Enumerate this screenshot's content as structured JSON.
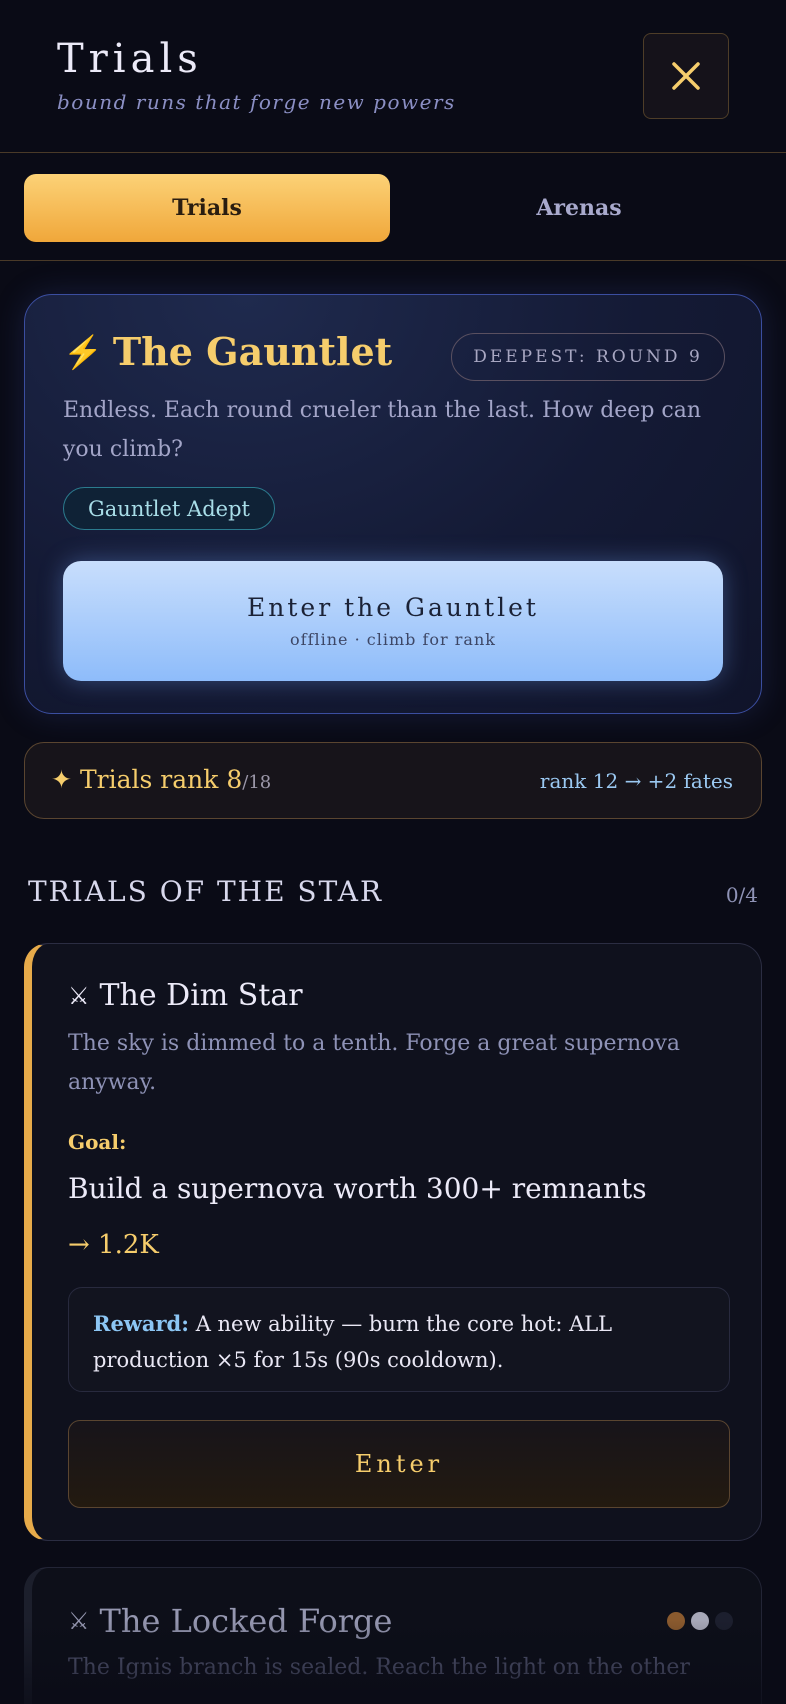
{
  "header": {
    "title": "Trials",
    "subtitle": "bound runs that forge new powers",
    "close_icon": "close-icon"
  },
  "tabs": [
    {
      "label": "Trials",
      "active": true
    },
    {
      "label": "Arenas",
      "active": false
    }
  ],
  "gauntlet": {
    "icon": "lightning-icon",
    "title": "The Gauntlet",
    "deepest": "DEEPEST: ROUND 9",
    "description": "Endless. Each round crueler than the last. How deep can you climb?",
    "badge": "Gauntlet Adept",
    "enter_label": "Enter the Gauntlet",
    "enter_sub": "offline · climb for rank"
  },
  "rank": {
    "icon": "sparkle-icon",
    "label": "Trials rank",
    "value": "8",
    "total": "/18",
    "next": "rank 12 → +2 fates"
  },
  "section": {
    "title": "TRIALS OF THE STAR",
    "count": "0/4"
  },
  "trials": [
    {
      "icon": "crossed-swords-icon",
      "name": "The Dim Star",
      "description": "The sky is dimmed to a tenth. Forge a great supernova anyway.",
      "goal_label": "Goal:",
      "goal": "Build a supernova worth 300+ remnants",
      "progress": "→ 1.2K",
      "reward_label": "Reward:",
      "reward": "A new ability — burn the core hot: ALL production ×5 for 15s (90s cooldown).",
      "enter_label": "Enter"
    },
    {
      "icon": "crossed-swords-icon",
      "name": "The Locked Forge",
      "description": "The Ignis branch is sealed. Reach the light on the other",
      "difficulty_colors": [
        "#8a5a2e",
        "#a7a8b8",
        "#1c1f2e"
      ]
    }
  ],
  "colors": {
    "gold": "#f6cd6c",
    "accent_blue": "#8ebcfa",
    "background": "#0a0b16"
  }
}
